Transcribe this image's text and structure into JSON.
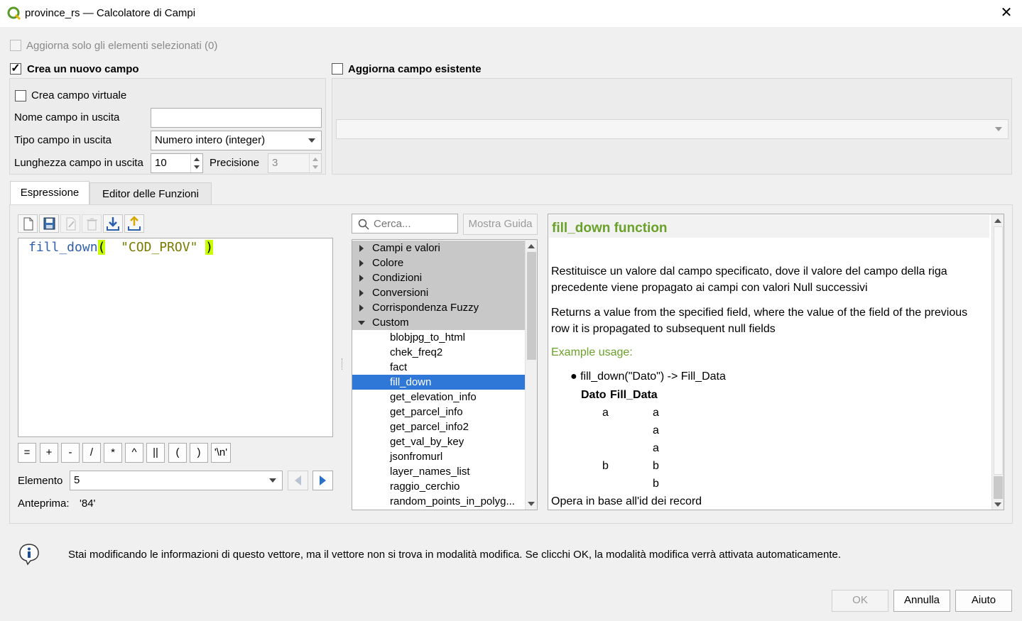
{
  "window": {
    "title": "province_rs — Calcolatore di Campi",
    "close_label": "✕"
  },
  "options": {
    "update_selected_label": "Aggiorna solo gli elementi selezionati (0)",
    "create_new_field_label": "Crea un nuovo campo",
    "update_existing_label": "Aggiorna campo esistente",
    "create_virtual_label": "Crea campo virtuale"
  },
  "new_field": {
    "name_label": "Nome campo in uscita",
    "name_value": "",
    "type_label": "Tipo campo in uscita",
    "type_value": "Numero intero (integer)",
    "length_label": "Lunghezza campo in uscita",
    "length_value": "10",
    "precision_label": "Precisione",
    "precision_value": "3"
  },
  "tabs": [
    {
      "label": "Espressione"
    },
    {
      "label": "Editor delle Funzioni"
    }
  ],
  "expression": {
    "func": "fill_down",
    "open_paren": "(",
    "field": "\"COD_PROV\"",
    "close_paren": ")"
  },
  "operators": [
    "=",
    "+",
    "-",
    "/",
    "*",
    "^",
    "||",
    "(",
    ")",
    "'\\n'"
  ],
  "element": {
    "label": "Elemento",
    "value": "5"
  },
  "preview": {
    "label": "Anteprima:",
    "value": "'84'"
  },
  "search": {
    "placeholder": "Cerca...",
    "guide_button": "Mostra Guida"
  },
  "tree": {
    "groups": [
      "Campi e valori",
      "Colore",
      "Condizioni",
      "Conversioni",
      "Corrispondenza Fuzzy",
      "Custom"
    ],
    "items": [
      "blobjpg_to_html",
      "chek_freq2",
      "fact",
      "fill_down",
      "get_elevation_info",
      "get_parcel_info",
      "get_parcel_info2",
      "get_val_by_key",
      "jsonfromurl",
      "layer_names_list",
      "raggio_cerchio",
      "random_points_in_polyg..."
    ]
  },
  "help": {
    "title": "fill_down function",
    "desc_it": "Restituisce un valore dal campo specificato, dove il valore del campo della riga precedente viene propagato ai campi con valori Null successivi",
    "desc_en": "Returns a value from the specified field, where the value of the field of the previous row it is propagated to subsequent null fields",
    "example_heading": "Example usage:",
    "example": "fill_down(\"Dato\") -> Fill_Data",
    "table_headers": [
      "Dato",
      "Fill_Data"
    ],
    "table_rows": [
      [
        "a",
        "a"
      ],
      [
        "",
        "a"
      ],
      [
        "",
        "a"
      ],
      [
        "b",
        "b"
      ],
      [
        "",
        "b"
      ]
    ],
    "footer": "Opera in base all'id dei record"
  },
  "info": {
    "message": "Stai modificando le informazioni di questo vettore, ma il vettore non si trova in modalità modifica. Se clicchi OK, la modalità modifica verrà attivata automaticamente."
  },
  "buttons": {
    "ok": "OK",
    "cancel": "Annulla",
    "help": "Aiuto"
  },
  "colors": {
    "accent": "#3078d7",
    "help_title": "#6aa12a",
    "code_blue": "#2f5fa8",
    "code_string": "#7a7a00",
    "bracket_highlight": "#c8ff00"
  }
}
